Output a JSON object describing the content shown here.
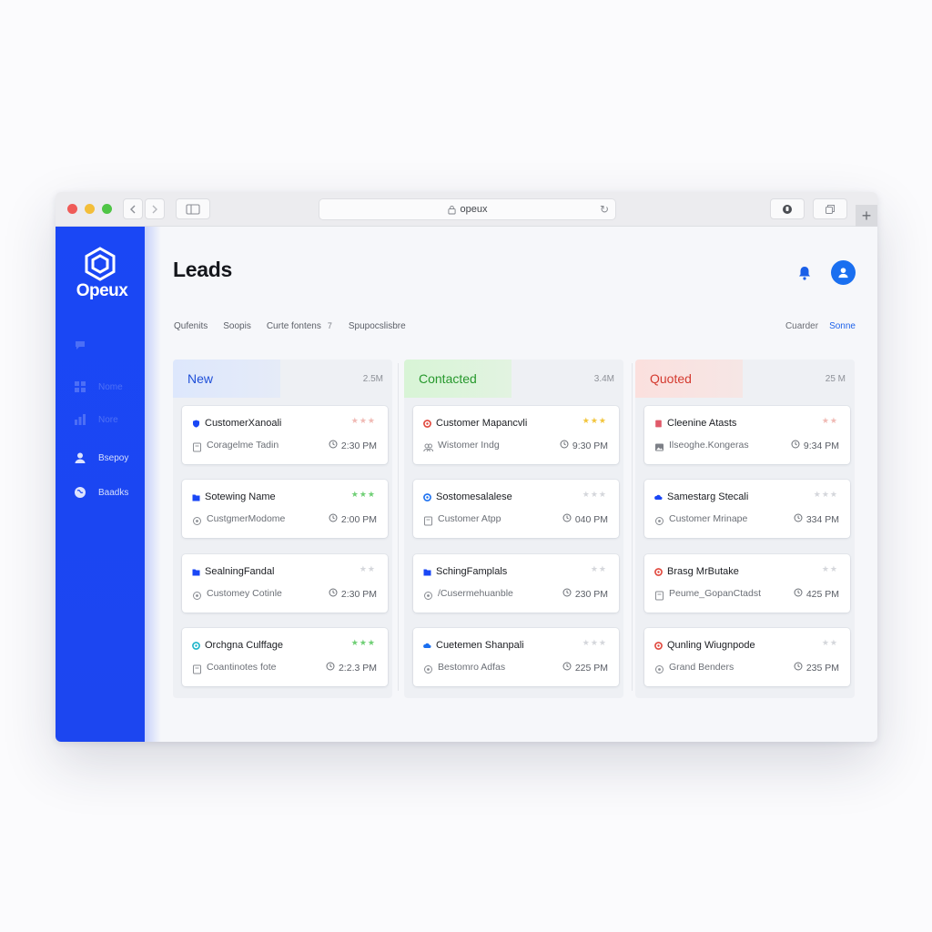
{
  "browser": {
    "url": "opeux"
  },
  "brand": {
    "name": "Opeux",
    "accent": "#1a47f5"
  },
  "sidebar": {
    "items": [
      {
        "label": "",
        "icon": "chat-icon"
      },
      {
        "label": "Nome",
        "icon": "grid-icon"
      },
      {
        "label": "Nore",
        "icon": "chart-icon"
      },
      {
        "label": "Bsepoy",
        "icon": "user-icon"
      },
      {
        "label": "Baadks",
        "icon": "globe-icon"
      }
    ]
  },
  "header": {
    "title": "Leads"
  },
  "filters": {
    "items": [
      "Qufenits",
      "Soopis",
      "Curte fontens"
    ],
    "count": "7",
    "last": "Spupocslisbre",
    "right_a": "Cuarder",
    "right_b": "Sonne"
  },
  "columns": [
    {
      "name": "New",
      "count": "2.5M",
      "color": "#1f4fd8",
      "cards": [
        {
          "title": "CustomerXanoali",
          "sub": "Coragelme Tadin",
          "time": "2:30 PM",
          "stars": "★★★",
          "star_color": "#f0b9b4",
          "dot_color": "#1a47f5",
          "dot": "shield-icon",
          "sub_icon": "document-icon"
        },
        {
          "title": "Sotewing Name",
          "sub": "CustgmerModome",
          "time": "2:00 PM",
          "stars": "★★★",
          "star_color": "#6fcf75",
          "dot_color": "#1a47f5",
          "dot": "folder-icon",
          "sub_icon": "circle-icon"
        },
        {
          "title": "SealningFandal",
          "sub": "Customey Cotinle",
          "time": "2:30 PM",
          "stars": "★★",
          "star_color": "#d4d6db",
          "dot_color": "#1a47f5",
          "dot": "folder-icon",
          "sub_icon": "circle-icon"
        },
        {
          "title": "Orchgna Culffage",
          "sub": "Coantinotes fote",
          "time": "2:2.3 PM",
          "stars": "★★★",
          "star_color": "#6fcf75",
          "dot_color": "#1ab3c8",
          "dot": "target-icon",
          "sub_icon": "document-icon"
        }
      ]
    },
    {
      "name": "Contacted",
      "count": "3.4M",
      "color": "#26982c",
      "cards": [
        {
          "title": "Customer Mapancvli",
          "sub": "Wistomer Indg",
          "time": "9:30 PM",
          "stars": "★★★",
          "star_color": "#f2c53d",
          "dot_color": "#e0453a",
          "dot": "target-icon",
          "sub_icon": "users-icon"
        },
        {
          "title": "Sostomesalalese",
          "sub": "Customer Atpp",
          "time": "040 PM",
          "stars": "★★★",
          "star_color": "#d4d6db",
          "dot_color": "#1a6ff0",
          "dot": "target-icon",
          "sub_icon": "document-icon"
        },
        {
          "title": "SchingFamplals",
          "sub": "/Cusermehuanble",
          "time": "230 PM",
          "stars": "★★",
          "star_color": "#d4d6db",
          "dot_color": "#1a47f5",
          "dot": "folder-icon",
          "sub_icon": "circle-icon"
        },
        {
          "title": "Cuetemen Shanpali",
          "sub": "Bestomro Adfas",
          "time": "225 PM",
          "stars": "★★★",
          "star_color": "#d4d6db",
          "dot_color": "#1a6ff0",
          "dot": "cloud-icon",
          "sub_icon": "circle-icon"
        }
      ]
    },
    {
      "name": "Quoted",
      "count": "25 M",
      "color": "#d43a2f",
      "cards": [
        {
          "title": "Cleenine Atasts",
          "sub": "Ilseoghe.Kongeras",
          "time": "9:34 PM",
          "stars": "★★",
          "star_color": "#f0b9b4",
          "dot_color": "#e05a6a",
          "dot": "document-icon",
          "sub_icon": "image-icon"
        },
        {
          "title": "Samestarg Stecali",
          "sub": "Customer Mrinape",
          "time": "334 PM",
          "stars": "★★★",
          "star_color": "#d4d6db",
          "dot_color": "#1a47f5",
          "dot": "cloud-icon",
          "sub_icon": "circle-icon"
        },
        {
          "title": "Brasg MrButake",
          "sub": "Peume_GopanCtadst",
          "time": "425 PM",
          "stars": "★★",
          "star_color": "#d4d6db",
          "dot_color": "#e0453a",
          "dot": "target-icon",
          "sub_icon": "document-icon"
        },
        {
          "title": "Qunling Wiugnpode",
          "sub": "Grand Benders",
          "time": "235 PM",
          "stars": "★★",
          "star_color": "#d4d6db",
          "dot_color": "#e0453a",
          "dot": "target-icon",
          "sub_icon": "circle-icon"
        }
      ]
    }
  ]
}
